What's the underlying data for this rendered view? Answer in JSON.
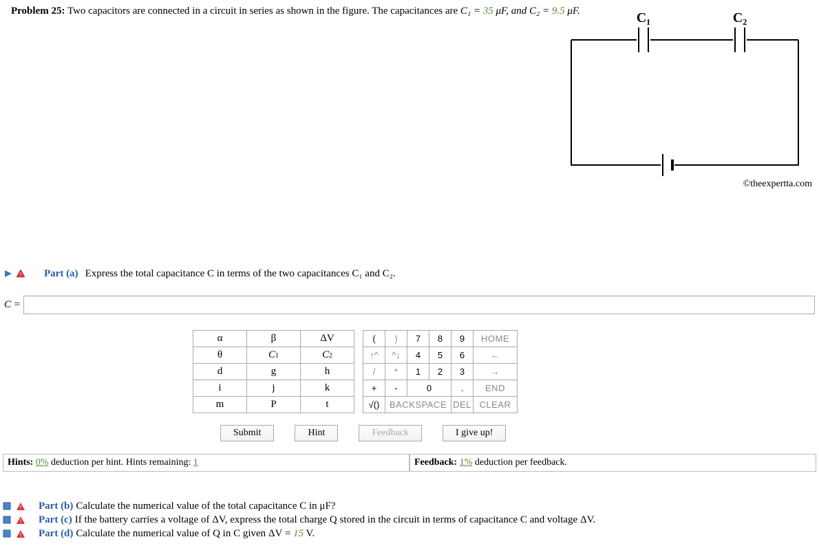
{
  "problem": {
    "label": "Problem 25:",
    "text_before": "Two capacitors are connected in a circuit in series as shown in the figure. The capacitances are ",
    "c1_expr": "C₁ = ",
    "c1_val": "35",
    "unit1": " μF, and ",
    "c2_expr": "C₂ = ",
    "c2_val": "9.5",
    "unit2": " μF."
  },
  "circuit": {
    "cap1": "C₁",
    "cap2": "C₂"
  },
  "copyright": "©theexpertta.com",
  "part_a": {
    "label": "Part (a)",
    "text": "Express the total capacitance C in terms of the two capacitances C₁ and C₂.",
    "prompt": "C =",
    "value": ""
  },
  "keypad": {
    "symbols": [
      [
        "α",
        "β",
        "ΔV"
      ],
      [
        "θ",
        "C₁",
        "C₂"
      ],
      [
        "d",
        "g",
        "h"
      ],
      [
        "i",
        "j",
        "k"
      ],
      [
        "m",
        "P",
        "t"
      ]
    ],
    "numpad": {
      "r1": [
        "(",
        ")",
        "7",
        "8",
        "9",
        "HOME"
      ],
      "r2": [
        "↑^",
        "^↓",
        "4",
        "5",
        "6",
        "←"
      ],
      "r3": [
        "/",
        "*",
        "1",
        "2",
        "3",
        "→"
      ],
      "r4": [
        "+",
        "-",
        "0",
        ".",
        "END"
      ],
      "r5": [
        "√()",
        "BACKSPACE",
        "DEL",
        "CLEAR"
      ]
    }
  },
  "actions": {
    "submit": "Submit",
    "hint": "Hint",
    "feedback": "Feedback",
    "giveup": "I give up!"
  },
  "hints": {
    "left_pre": "Hints: ",
    "left_pct": "0%",
    "left_mid": " deduction per hint. Hints remaining: ",
    "left_rem": "1",
    "right_pre": "Feedback: ",
    "right_pct": "1%",
    "right_post": " deduction per feedback."
  },
  "parts": {
    "b": {
      "label": "Part (b)",
      "text": "Calculate the numerical value of the total capacitance C in μF?"
    },
    "c": {
      "label": "Part (c)",
      "text": "If the battery carries a voltage of ΔV, express the total charge Q stored in the circuit in terms of capacitance C and voltage ΔV."
    },
    "d": {
      "label": "Part (d)",
      "text_pre": "Calculate the numerical value of Q in C given ΔV = ",
      "val": "15",
      "text_post": " V."
    }
  }
}
